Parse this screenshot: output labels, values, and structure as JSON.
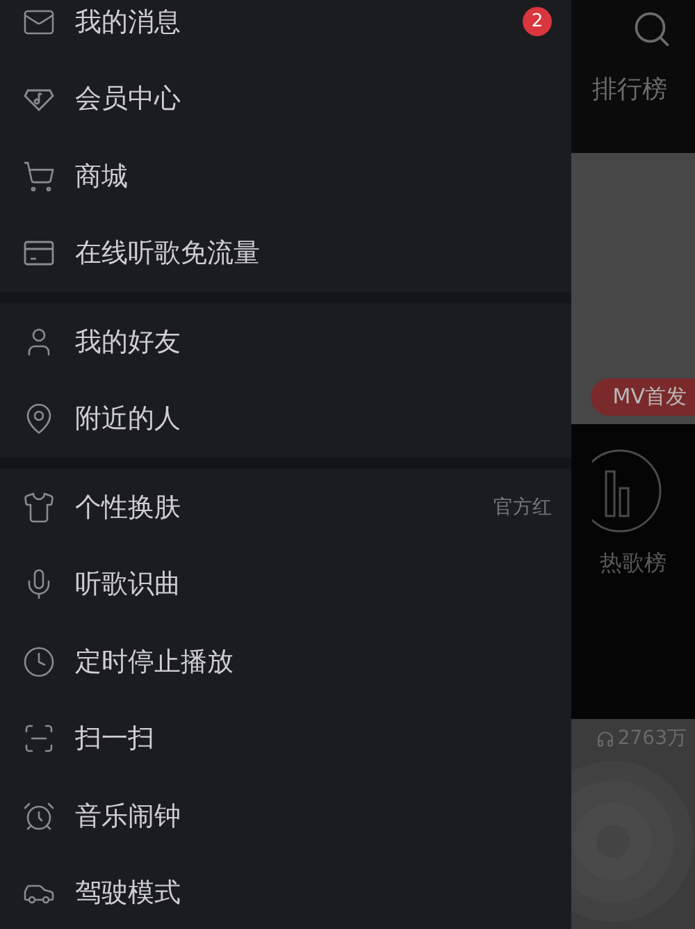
{
  "menu_groups": [
    {
      "items": [
        {
          "label": "我的消息",
          "badge": "2"
        },
        {
          "label": "会员中心"
        },
        {
          "label": "商城"
        },
        {
          "label": "在线听歌免流量"
        }
      ]
    },
    {
      "items": [
        {
          "label": "我的好友"
        },
        {
          "label": "附近的人"
        }
      ]
    },
    {
      "items": [
        {
          "label": "个性换肤",
          "value": "官方红"
        },
        {
          "label": "听歌识曲"
        },
        {
          "label": "定时停止播放"
        },
        {
          "label": "扫一扫"
        },
        {
          "label": "音乐闹钟"
        },
        {
          "label": "驾驶模式"
        }
      ]
    }
  ],
  "background": {
    "tab_label": "排行榜",
    "banner_tag": "MV首发",
    "chart_label": "热歌榜",
    "play_count": "2763万"
  }
}
